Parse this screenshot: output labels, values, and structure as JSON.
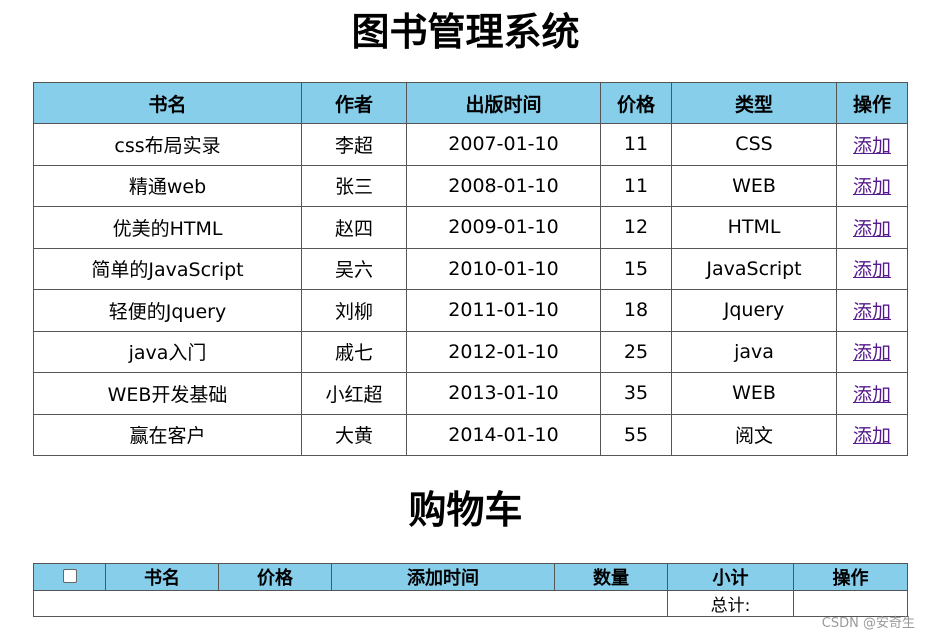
{
  "books": {
    "title": "图书管理系统",
    "headers": [
      "书名",
      "作者",
      "出版时间",
      "价格",
      "类型",
      "操作"
    ],
    "rows": [
      {
        "name": "css布局实录",
        "author": "李超",
        "date": "2007-01-10",
        "price": "11",
        "type": "CSS",
        "action": "添加"
      },
      {
        "name": "精通web",
        "author": "张三",
        "date": "2008-01-10",
        "price": "11",
        "type": "WEB",
        "action": "添加"
      },
      {
        "name": "优美的HTML",
        "author": "赵四",
        "date": "2009-01-10",
        "price": "12",
        "type": "HTML",
        "action": "添加"
      },
      {
        "name": "简单的JavaScript",
        "author": "吴六",
        "date": "2010-01-10",
        "price": "15",
        "type": "JavaScript",
        "action": "添加"
      },
      {
        "name": "轻便的Jquery",
        "author": "刘柳",
        "date": "2011-01-10",
        "price": "18",
        "type": "Jquery",
        "action": "添加"
      },
      {
        "name": "java入门",
        "author": "戚七",
        "date": "2012-01-10",
        "price": "25",
        "type": "java",
        "action": "添加"
      },
      {
        "name": "WEB开发基础",
        "author": "小红超",
        "date": "2013-01-10",
        "price": "35",
        "type": "WEB",
        "action": "添加"
      },
      {
        "name": "赢在客户",
        "author": "大黄",
        "date": "2014-01-10",
        "price": "55",
        "type": "阅文",
        "action": "添加"
      }
    ]
  },
  "cart": {
    "title": "购物车",
    "headers": [
      "书名",
      "价格",
      "添加时间",
      "数量",
      "小计",
      "操作"
    ],
    "total_label": "总计:",
    "total_value": ""
  },
  "watermark": "CSDN @安奇生"
}
